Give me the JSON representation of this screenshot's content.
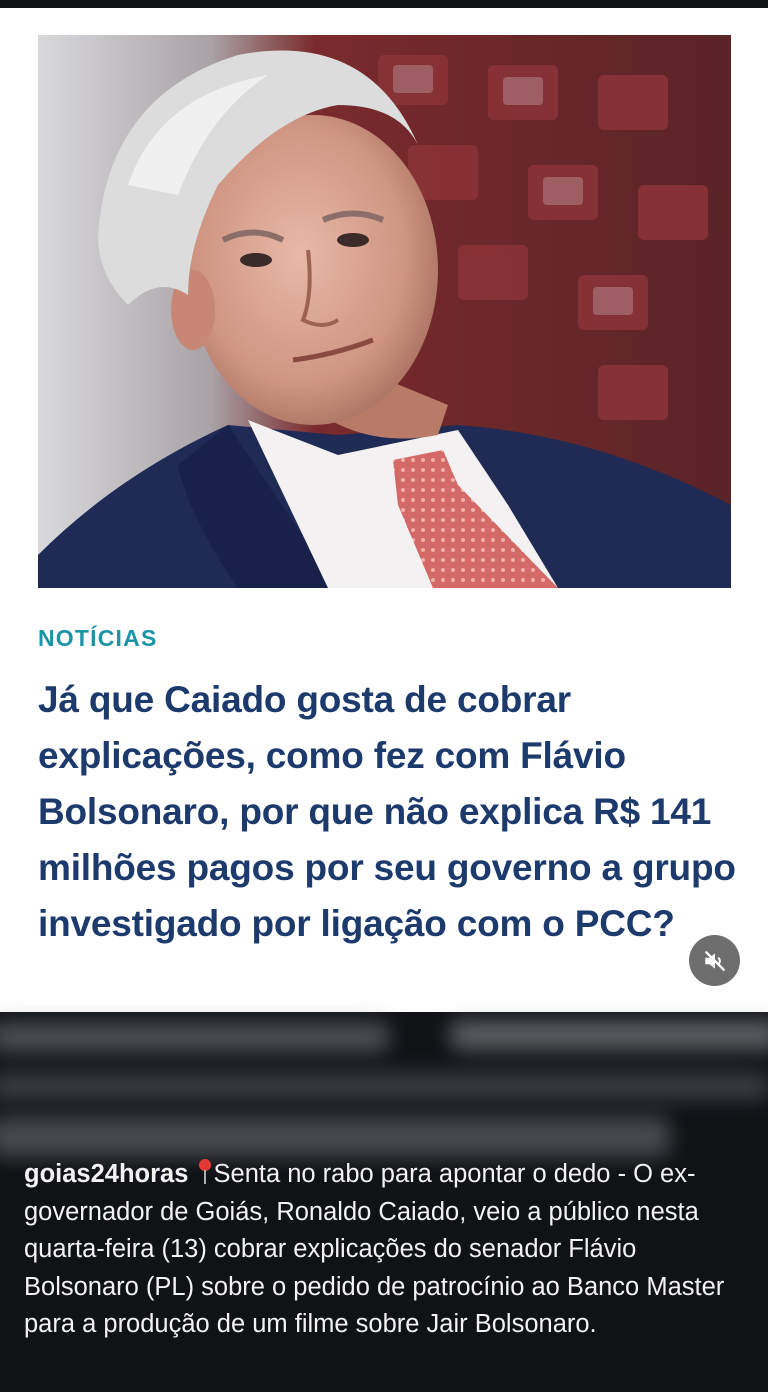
{
  "post": {
    "image": {
      "subject": "photo-portrait"
    },
    "category": "NOTÍCIAS",
    "headline": "Já que Caiado gosta de cobrar explicações, como fez com Flávio Bolsonaro, por que não explica R$ 141 milhões pagos por seu governo a grupo investigado por ligação com o PCC?",
    "mute_icon": "speaker-muted-icon"
  },
  "caption": {
    "username": "goias24horas",
    "pin_icon": "round-pushpin-icon",
    "text": "Senta no rabo para apontar o dedo - O ex-governador de Goiás, Ronaldo Caiado, veio a público nesta quarta-feira (13) cobrar explicações do senador Flávio Bolsonaro (PL) sobre o pedido de patrocínio ao Banco Master para a produção de um filme sobre Jair Bolsonaro."
  },
  "colors": {
    "category": "#1b94a6",
    "headline": "#1d3a6d",
    "caption_bg": "#101216",
    "caption_text": "#f2f2f2"
  }
}
